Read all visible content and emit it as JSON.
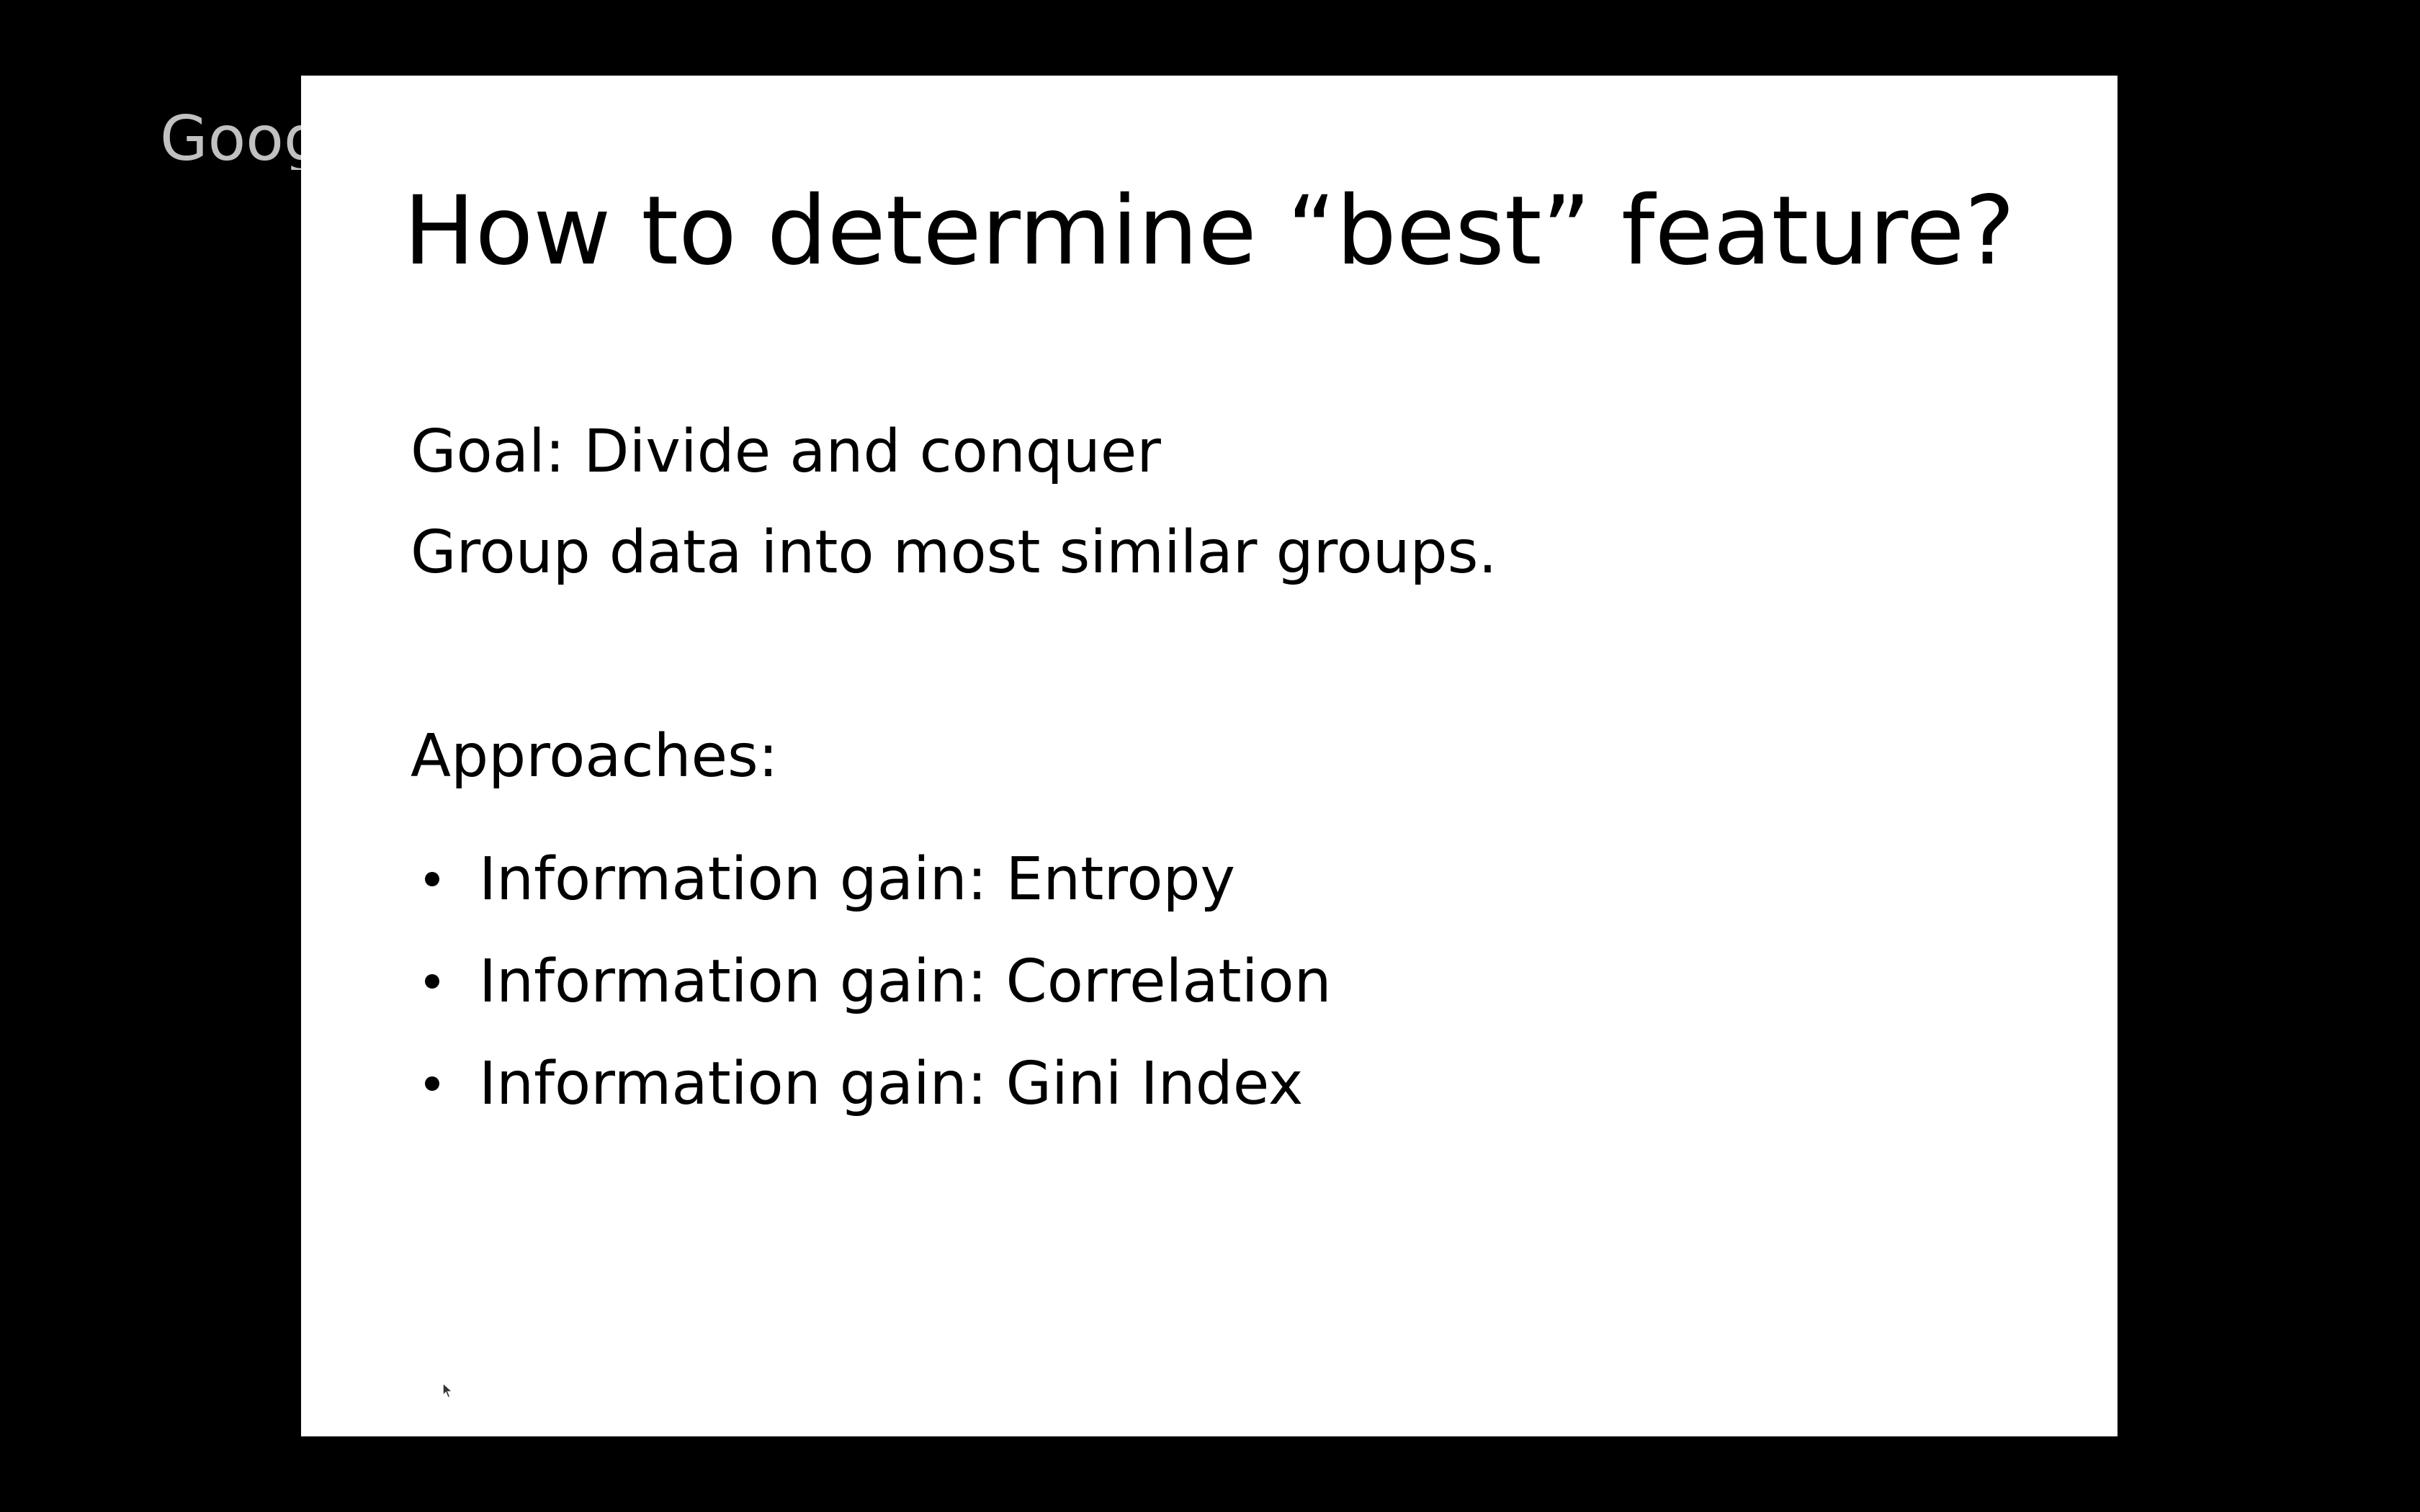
{
  "watermark": {
    "text": "Google"
  },
  "slide": {
    "title": "How to determine “best” feature?",
    "goal": "Goal: Divide and conquer",
    "group": "Group data into most similar groups.",
    "approaches_heading": "Approaches:",
    "bullets": [
      {
        "text": "Information gain: Entropy"
      },
      {
        "text": "Information gain: Correlation"
      },
      {
        "text": "Information gain: Gini Index"
      }
    ]
  },
  "cursor": {
    "icon": "mouse-pointer-icon"
  }
}
